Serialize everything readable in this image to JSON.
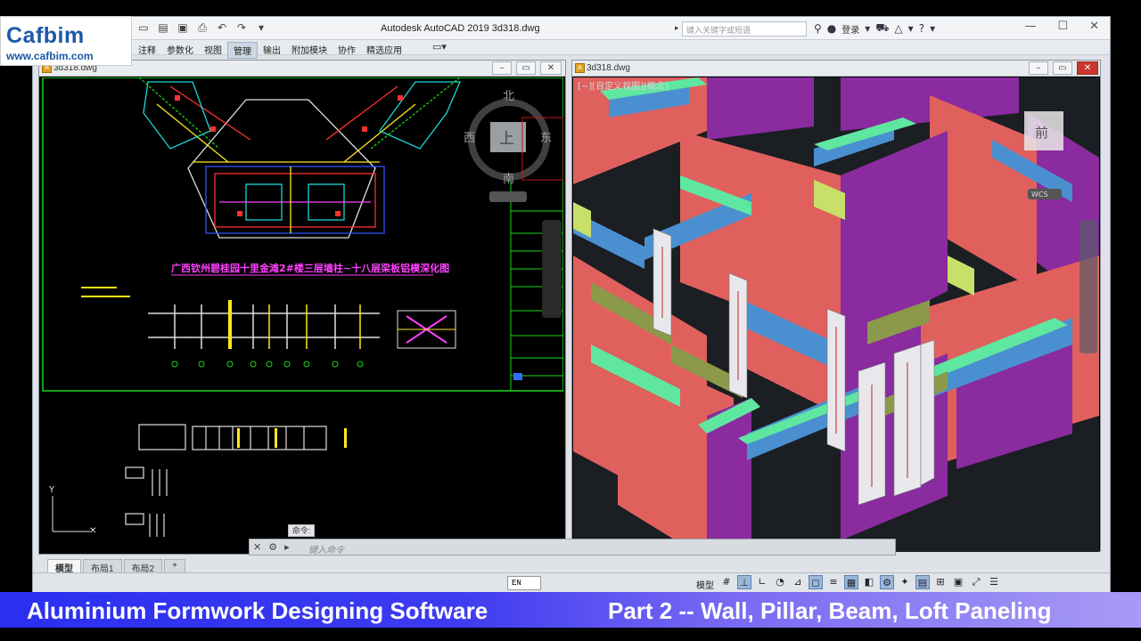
{
  "logo": {
    "name": "Cafbim",
    "url": "www.cafbim.com"
  },
  "app": {
    "title": "Autodesk AutoCAD 2019   3d318.dwg",
    "search_placeholder": "键入关键字或短语",
    "login_label": "登录",
    "window_controls": [
      "—",
      "☐",
      "✕"
    ]
  },
  "ribbon": {
    "tabs": [
      "注释",
      "参数化",
      "视图",
      "管理",
      "输出",
      "附加模块",
      "协作",
      "精选应用"
    ],
    "active": "管理"
  },
  "left_window": {
    "title": "3d318.dwg",
    "drawing_title": "广西钦州碧桂园十里金滩2#楼三层墙柱~十八层梁板铝模深化图",
    "compass": {
      "north": "北",
      "south": "南",
      "east": "东",
      "west": "西",
      "top": "上"
    },
    "ucs_label": "Y"
  },
  "right_window": {
    "title": "3d318.dwg",
    "view_label": "[−][自定义视图][概念]",
    "wcs_label": "WCS",
    "cube_face": "前"
  },
  "command": {
    "prompt": "命令:",
    "placeholder": "键入命令"
  },
  "layout_tabs": [
    "模型",
    "布局1",
    "布局2",
    "+"
  ],
  "status": {
    "ime": "EN",
    "model": "模型"
  },
  "banner": {
    "left": "Aluminium Formwork Designing Software",
    "right": "Part 2 --  Wall, Pillar, Beam, Loft Paneling"
  },
  "colors": {
    "wall_red": "#e0605e",
    "wall_purple": "#8a2ba0",
    "beam_blue": "#4a90d0",
    "beam_green": "#5fe6a0",
    "banner_blue": "#2a2ff0"
  }
}
